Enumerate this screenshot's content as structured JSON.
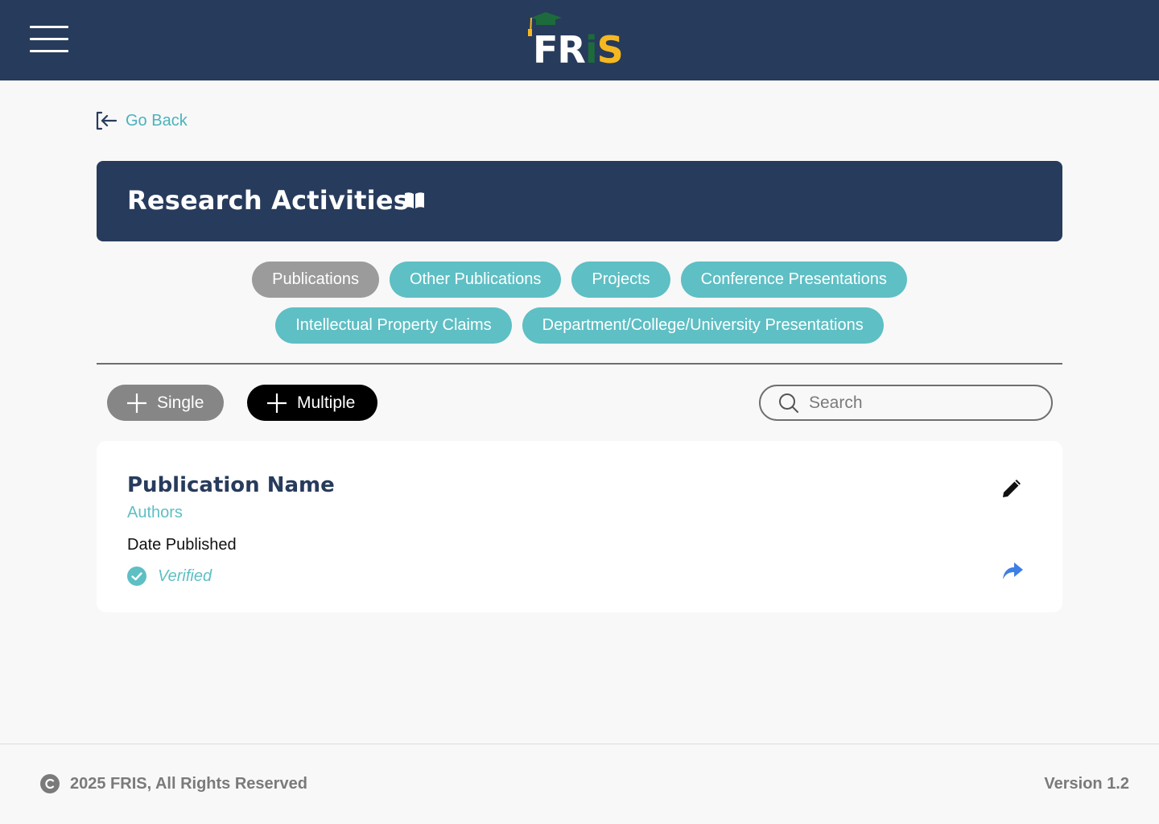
{
  "header": {
    "logo": {
      "text_fr": "FR",
      "text_i": "i",
      "text_s": "S"
    },
    "menu_icon": "hamburger-menu-icon"
  },
  "nav": {
    "go_back_label": "Go Back",
    "go_back_icon": "sign-out-arrow-left-icon"
  },
  "banner": {
    "title": "Research Activities",
    "icon": "book-open-icon"
  },
  "tabs": {
    "row1": [
      {
        "label": "Publications",
        "active": true
      },
      {
        "label": "Other Publications",
        "active": false
      },
      {
        "label": "Projects",
        "active": false
      },
      {
        "label": "Conference Presentations",
        "active": false
      }
    ],
    "row2": [
      {
        "label": "Intellectual Property Claims",
        "active": false
      },
      {
        "label": "Department/College/University Presentations",
        "active": false
      }
    ]
  },
  "toolbar": {
    "single_label": "Single",
    "multiple_label": "Multiple",
    "search_placeholder": "Search"
  },
  "publication": {
    "title": "Publication Name",
    "authors": "Authors",
    "date": "Date Published",
    "status": "Verified"
  },
  "footer": {
    "copyright": "2025 FRIS, All Rights Reserved",
    "version": "Version 1.2"
  },
  "colors": {
    "navy": "#273b5c",
    "teal": "#5ebfc4",
    "active_tab": "#9b9b9b",
    "share_blue": "#3d7fe6",
    "logo_green": "#1d6b3c",
    "logo_yellow": "#f5b820"
  }
}
